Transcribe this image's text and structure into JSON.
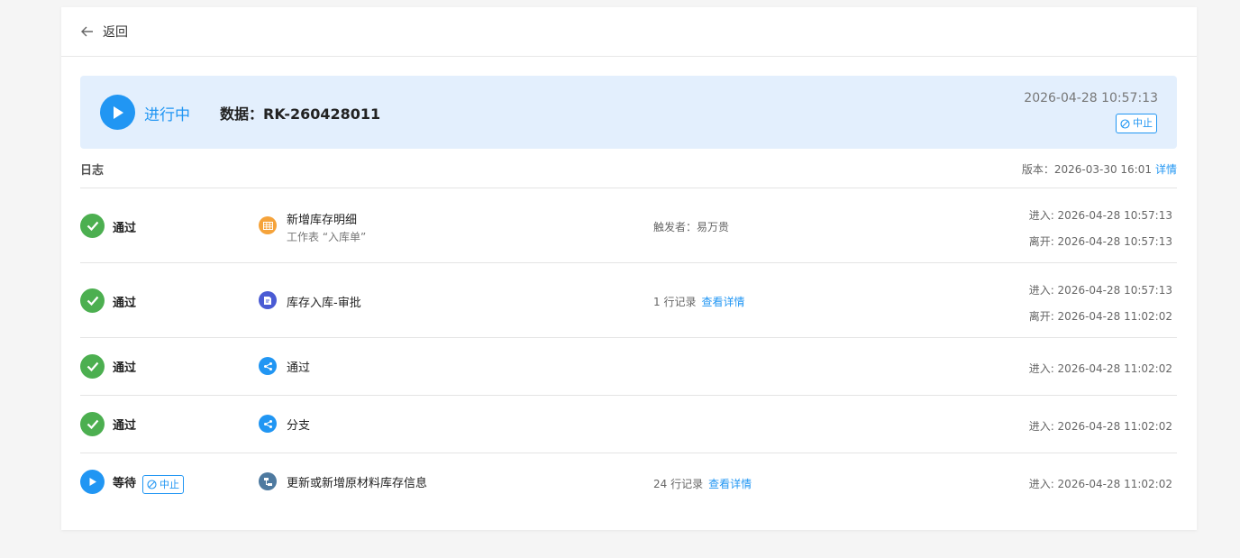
{
  "header": {
    "back_label": "返回"
  },
  "banner": {
    "status": "进行中",
    "data_label": "数据：RK-260428011",
    "time": "2026-04-28 10:57:13",
    "stop_label": "中止"
  },
  "log": {
    "title": "日志",
    "version_text": "版本：2026-03-30 16:01",
    "version_link": "详情"
  },
  "rows": [
    {
      "status": "通过",
      "node_name": "新增库存明细",
      "node_sub": "工作表 “入库单”",
      "node_icon": "table-icon",
      "node_color": "#f5a33b",
      "mid_text": "触发者：易万贵",
      "enter": "进入: 2026-04-28 10:57:13",
      "leave": "离开: 2026-04-28 10:57:13"
    },
    {
      "status": "通过",
      "node_name": "库存入库-审批",
      "node_icon": "approval-icon",
      "node_color": "#4a5bd4",
      "mid_text": "1 行记录",
      "mid_link": "查看详情",
      "enter": "进入: 2026-04-28 10:57:13",
      "leave": "离开: 2026-04-28 11:02:02"
    },
    {
      "status": "通过",
      "node_name": "通过",
      "node_icon": "branch-icon",
      "node_color": "#2196f3",
      "enter": "进入: 2026-04-28 11:02:02"
    },
    {
      "status": "通过",
      "node_name": "分支",
      "node_icon": "branch-icon",
      "node_color": "#2196f3",
      "enter": "进入: 2026-04-28 11:02:02"
    },
    {
      "status": "等待",
      "stop_label": "中止",
      "node_name": "更新或新增原材料库存信息",
      "node_icon": "update-record-icon",
      "node_color": "#4e7aa0",
      "mid_text": "24 行记录",
      "mid_link": "查看详情",
      "enter": "进入: 2026-04-28 11:02:02"
    }
  ],
  "colors": {
    "accent": "#2196f3",
    "success": "#4caf50",
    "banner_bg": "#e3effd"
  }
}
